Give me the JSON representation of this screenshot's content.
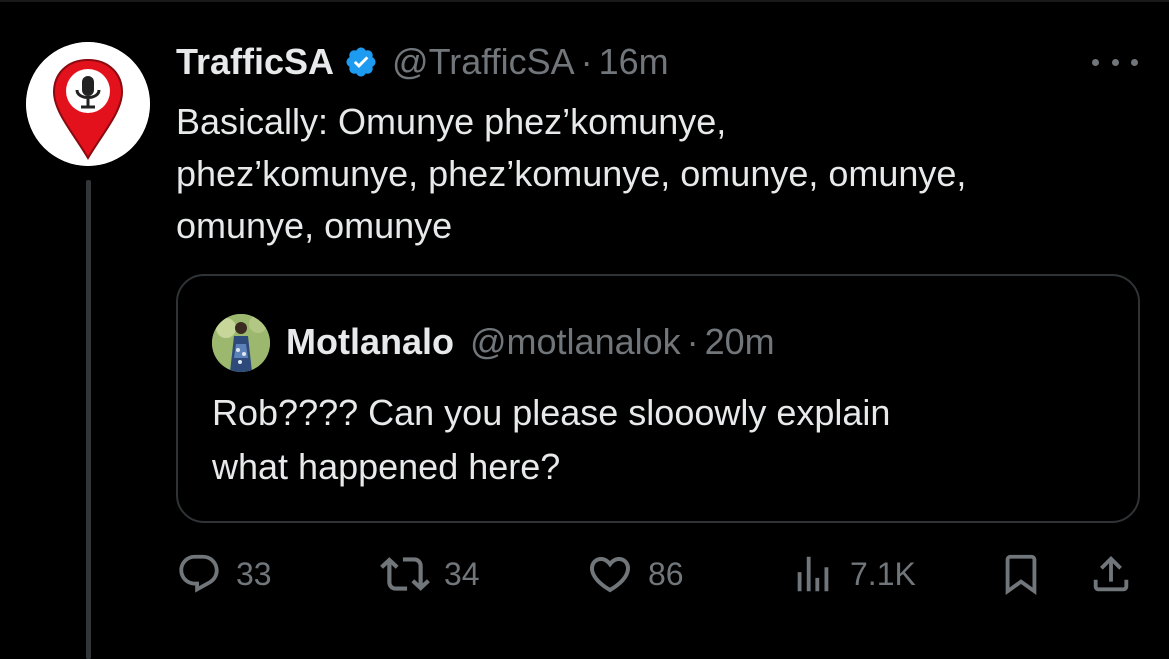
{
  "tweet": {
    "author_name": "TrafficSA",
    "handle": "@TrafficSA",
    "separator": "·",
    "time": "16m",
    "text": "Basically:  Omunye phez’komunye,\nphez’komunye, phez’komunye, omunye, omunye,\nomunye, omunye"
  },
  "quote": {
    "author_name": "Motlanalo",
    "handle": "@motlanalok",
    "separator": "·",
    "time": "20m",
    "text": "Rob???? Can you please slooowly explain\nwhat happened here?"
  },
  "actions": {
    "replies": "33",
    "reposts": "34",
    "likes": "86",
    "views": "7.1K"
  },
  "icons": {
    "verified": "verified-badge-icon",
    "more": "more-icon",
    "reply": "reply-icon",
    "repost": "repost-icon",
    "like": "heart-icon",
    "views": "views-icon",
    "bookmark": "bookmark-icon",
    "share": "share-icon"
  },
  "colors": {
    "background": "#000000",
    "text": "#e7e9ea",
    "muted": "#71767b",
    "verified_blue": "#1d9bf0",
    "avatar_pin_red": "#e3111b"
  }
}
